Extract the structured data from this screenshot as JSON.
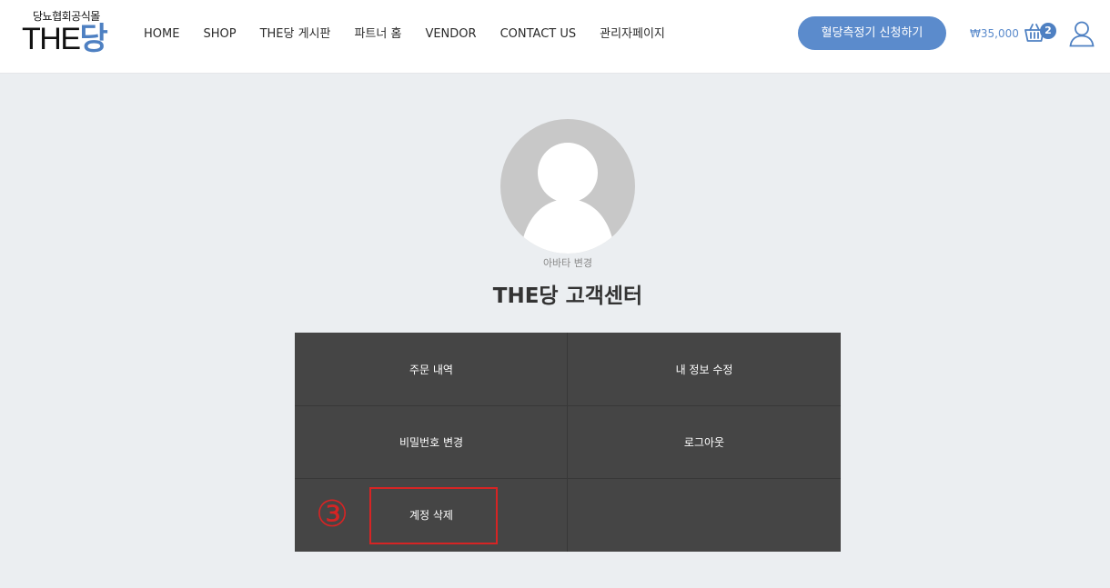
{
  "header": {
    "logo_subtitle": "당뇨협회공식몰",
    "logo_the": "THE",
    "logo_dang": "당",
    "nav": [
      "HOME",
      "SHOP",
      "THE당 게시판",
      "파트너 홈",
      "VENDOR",
      "CONTACT US",
      "관리자페이지"
    ],
    "cta_label": "혈당측정기 신청하기",
    "cart_total": "₩35,000",
    "cart_count": "2",
    "icons": {
      "cart": "shopping-basket-icon",
      "user": "user-account-icon"
    }
  },
  "profile": {
    "avatar_icon": "default-avatar-icon",
    "change_avatar_label": "아바타 변경",
    "title": "THE당 고객센터"
  },
  "menu": {
    "items": [
      "주문 내역",
      "내 정보 수정",
      "비밀번호 변경",
      "로그아웃",
      "계정 삭제",
      ""
    ]
  },
  "annotation": {
    "step_marker": "③",
    "highlight_color": "#d62424"
  },
  "colors": {
    "accent": "#5b8bcc",
    "menu_background": "#454545",
    "page_background": "#ebeef1"
  }
}
